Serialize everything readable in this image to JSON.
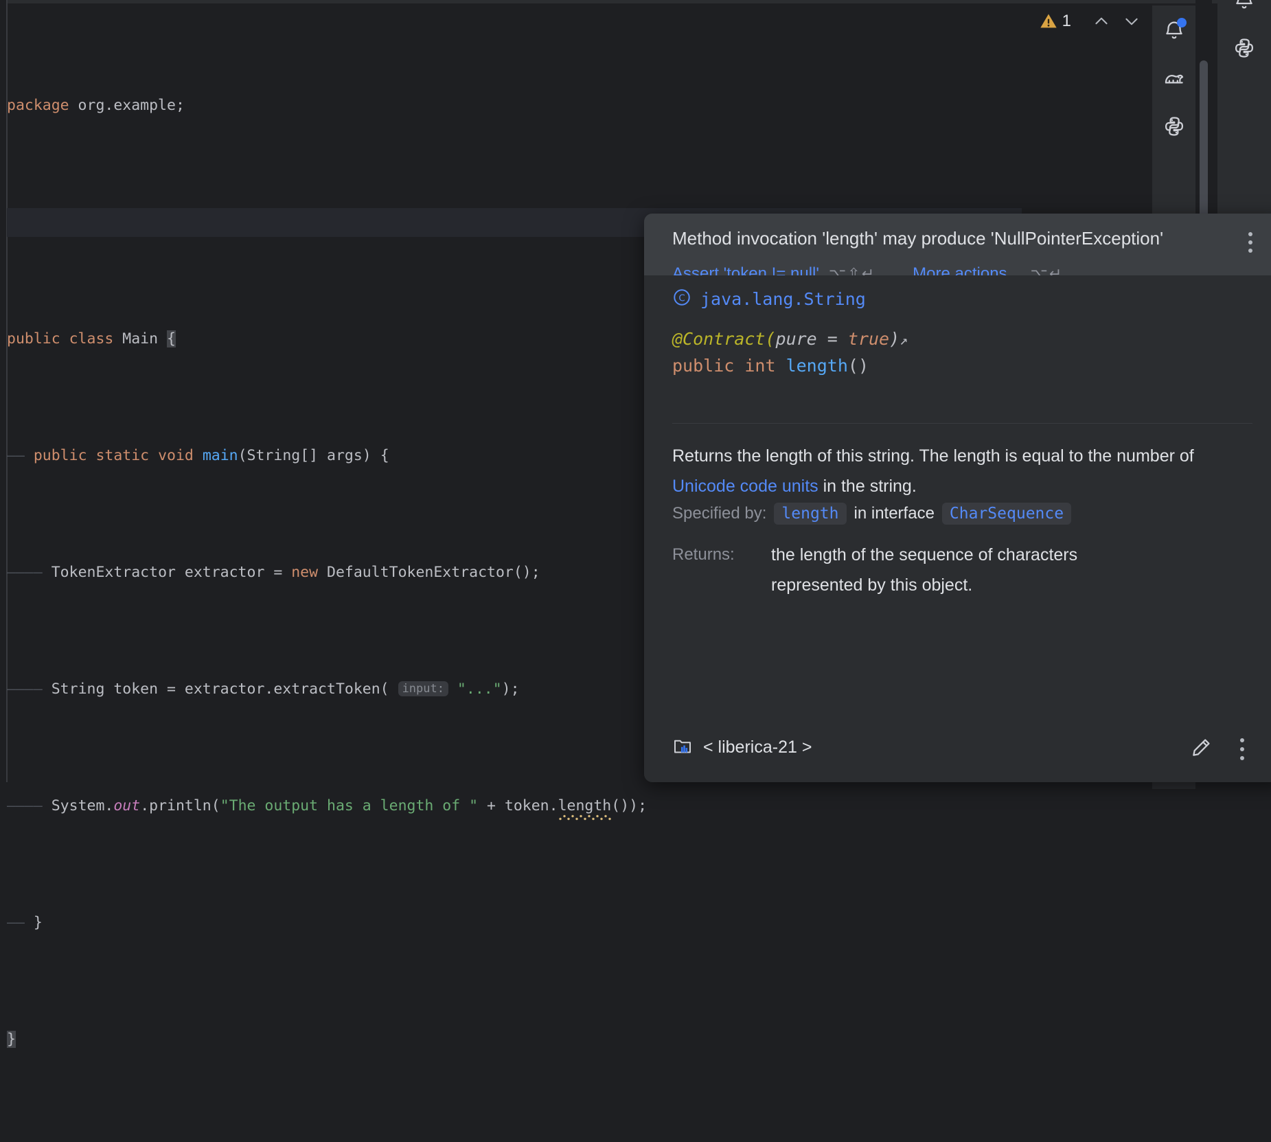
{
  "editor": {
    "language": "java",
    "lines": [
      {
        "id": "l1",
        "text": "package org.example;"
      },
      {
        "id": "l2",
        "text": ""
      },
      {
        "id": "l3",
        "text": "public class Main {"
      },
      {
        "id": "l4",
        "text": "    public static void main(String[] args) {"
      },
      {
        "id": "l5",
        "text": "        TokenExtractor extractor = new DefaultTokenExtractor();"
      },
      {
        "id": "l6",
        "text": "        String token = extractor.extractToken( input: \"...\");"
      },
      {
        "id": "l7",
        "text": "        System.out.println(\"The output has a length of \" + token.length());"
      },
      {
        "id": "l8",
        "text": "    }"
      },
      {
        "id": "l9",
        "text": "}"
      }
    ],
    "tokens": {
      "kw_package": "package",
      "pkg_name": " org.example;",
      "kw_public": "public",
      "kw_class": " class ",
      "class_main": "Main ",
      "brace_open": "{",
      "kw_public2": "public",
      "kw_static": " static ",
      "kw_void": "void ",
      "fn_main": "main",
      "main_args": "(String[] args) {",
      "decl_extractor": "TokenExtractor extractor = ",
      "kw_new": "new",
      "ctor_call": " DefaultTokenExtractor();",
      "decl_token": "String token = extractor.extractToken( ",
      "param_hint": "input:",
      "str_dots": " \"...\"",
      "close_semi": ");",
      "sys": "System.",
      "out_field": "out",
      "println": ".println(",
      "str_msg": "\"The output has a length of \"",
      "plus_token": " + token.",
      "length_call": "length",
      "tail": "());",
      "close_brace_inner": "}",
      "close_brace_outer": "}",
      "indent_guide": "——"
    },
    "colors": {
      "background": "#1e1f22",
      "keyword": "#cf8e6d",
      "string": "#6aab73",
      "method": "#56a8f5",
      "static_field": "#c77dbb",
      "plain": "#bcbec4",
      "warning_squiggle": "#d5b778",
      "caret_line": "#26282e"
    }
  },
  "inspection_widget": {
    "warning_icon": "warning-triangle-icon",
    "warning_count": "1",
    "prev_label": "chevron-up-icon",
    "next_label": "chevron-down-icon"
  },
  "sidebar_primary": {
    "items": [
      {
        "id": "notifications",
        "icon": "bell-icon",
        "has_badge": true
      },
      {
        "id": "gradle",
        "icon": "elephant-icon",
        "has_badge": false
      },
      {
        "id": "python-packages",
        "icon": "python-icon",
        "has_badge": false
      }
    ]
  },
  "sidebar_secondary": {
    "items": [
      {
        "id": "notifications-2",
        "icon": "bell-icon"
      },
      {
        "id": "python-2",
        "icon": "python-icon"
      }
    ]
  },
  "popup": {
    "title": "Method invocation 'length' may produce 'NullPointerException'",
    "kebab_label": "more-options",
    "actions": [
      {
        "id": "assert",
        "label": "Assert 'token != null'",
        "shortcut": "⌥⇧↵"
      },
      {
        "id": "more",
        "label": "More actions...",
        "shortcut": "⌥↵"
      }
    ],
    "owner": {
      "icon": "class-icon",
      "icon_glyph": "C",
      "name": "java.lang.String"
    },
    "signature": {
      "annotation": "@Contract(",
      "annotation_param": "pure",
      "annotation_eq": " = ",
      "annotation_value": "true",
      "annotation_close": ")",
      "external_link": "↗",
      "modifiers": "public ",
      "return_type": "int ",
      "method_name": "length",
      "parens": "()"
    },
    "doc": {
      "part1": "Returns the length of this string. The length is equal to the number of ",
      "link": "Unicode code units",
      "part2": " in the string."
    },
    "specified_by": {
      "label": "Specified by:",
      "member": "length",
      "connector": "in interface",
      "interface": "CharSequence"
    },
    "returns": {
      "label": "Returns:",
      "value": "the length of the sequence of characters represented by this object."
    },
    "footer": {
      "sdk_icon": "library-folder-icon",
      "sdk_name": "< liberica-21 >",
      "edit_icon": "pencil-icon",
      "menu_icon": "more-options-icon"
    },
    "colors": {
      "header_bg": "#3c3f43",
      "body_bg": "#2b2d30",
      "link": "#548af7",
      "label": "#8d9099",
      "text": "#dfe1e5"
    }
  }
}
